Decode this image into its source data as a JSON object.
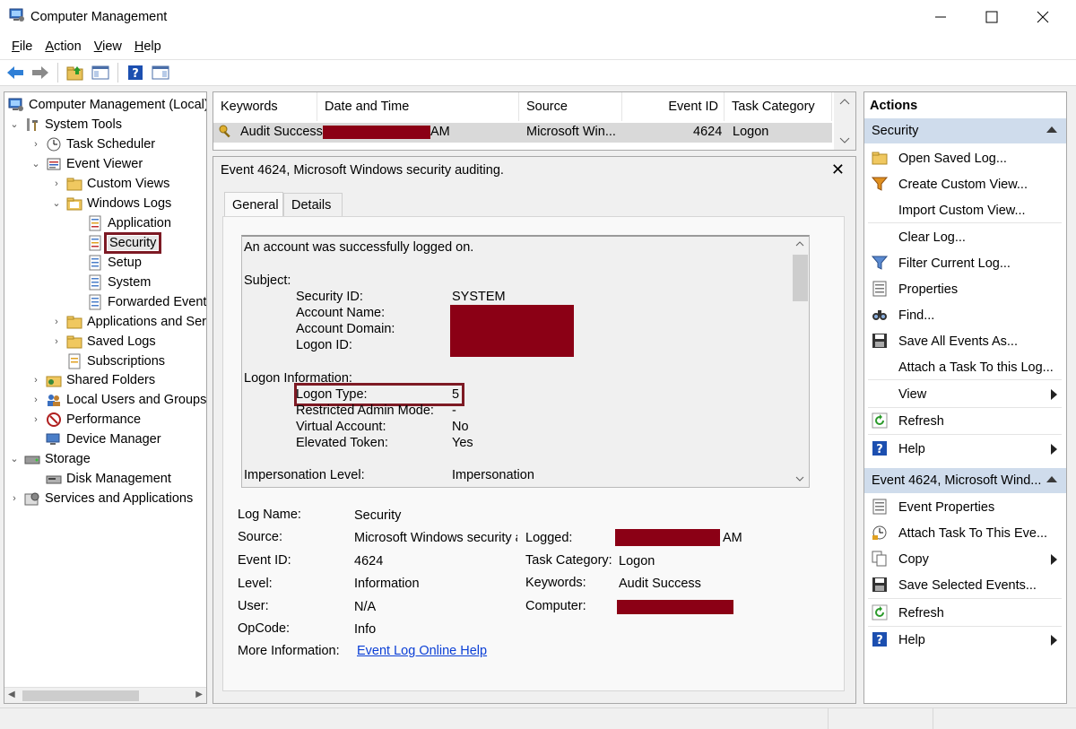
{
  "window": {
    "title": "Computer Management"
  },
  "menu": [
    {
      "key": "F",
      "rest": "ile"
    },
    {
      "key": "A",
      "rest": "ction"
    },
    {
      "key": "V",
      "rest": "iew"
    },
    {
      "key": "H",
      "rest": "elp"
    }
  ],
  "tree": {
    "root": "Computer Management (Local)",
    "system_tools": "System Tools",
    "task_scheduler": "Task Scheduler",
    "event_viewer": "Event Viewer",
    "custom_views": "Custom Views",
    "windows_logs": "Windows Logs",
    "application": "Application",
    "security": "Security",
    "setup": "Setup",
    "system": "System",
    "forwarded": "Forwarded Event",
    "apps_services": "Applications and Ser",
    "saved_logs": "Saved Logs",
    "subscriptions": "Subscriptions",
    "shared_folders": "Shared Folders",
    "local_users": "Local Users and Groups",
    "performance": "Performance",
    "device_manager": "Device Manager",
    "storage": "Storage",
    "disk_management": "Disk Management",
    "services_apps": "Services and Applications"
  },
  "events": {
    "columns": [
      "Keywords",
      "Date and Time",
      "Source",
      "Event ID",
      "Task Category"
    ],
    "row": {
      "keywords": "Audit Success",
      "date_suffix": "AM",
      "source": "Microsoft Win...",
      "event_id": "4624",
      "task_category": "Logon"
    }
  },
  "detail": {
    "title": "Event 4624, Microsoft Windows security auditing.",
    "close": "✕",
    "tabs": [
      "General",
      "Details"
    ],
    "message": {
      "intro": "An account was successfully logged on.",
      "subject": "Subject:",
      "security_id_label": "Security ID:",
      "security_id_value": "SYSTEM",
      "account_name_label": "Account Name:",
      "account_domain_label": "Account Domain:",
      "logon_id_label": "Logon ID:",
      "logon_info": "Logon Information:",
      "logon_type_label": "Logon Type:",
      "logon_type_value": "5",
      "restricted_label": "Restricted Admin Mode:",
      "restricted_value": "-",
      "virtual_label": "Virtual Account:",
      "virtual_value": "No",
      "elevated_label": "Elevated Token:",
      "elevated_value": "Yes",
      "impersonation_label": "Impersonation Level:",
      "impersonation_value": "Impersonation"
    },
    "props": {
      "log_name_label": "Log Name:",
      "log_name": "Security",
      "source_label": "Source:",
      "source": "Microsoft Windows security a",
      "logged_label": "Logged:",
      "logged_suffix": "AM",
      "event_id_label": "Event ID:",
      "event_id": "4624",
      "task_category_label": "Task Category:",
      "task_category": "Logon",
      "level_label": "Level:",
      "level": "Information",
      "keywords_label": "Keywords:",
      "keywords": "Audit Success",
      "user_label": "User:",
      "user": "N/A",
      "computer_label": "Computer:",
      "opcode_label": "OpCode:",
      "opcode": "Info",
      "more_info_label": "More Information:",
      "more_info_link": "Event Log Online Help"
    }
  },
  "actions": {
    "header": "Actions",
    "section1": "Security",
    "section1_items": [
      "Open Saved Log...",
      "Create Custom View...",
      "Import Custom View...",
      "Clear Log...",
      "Filter Current Log...",
      "Properties",
      "Find...",
      "Save All Events As...",
      "Attach a Task To this Log...",
      "View",
      "Refresh",
      "Help"
    ],
    "section2": "Event 4624, Microsoft Wind...",
    "section2_items": [
      "Event Properties",
      "Attach Task To This Eve...",
      "Copy",
      "Save Selected Events...",
      "Refresh",
      "Help"
    ]
  },
  "colors": {
    "redaction": "#8b0015",
    "highlight_box": "#7d1a24",
    "section_bg": "#cfdcec",
    "link": "#0b3fd6"
  }
}
